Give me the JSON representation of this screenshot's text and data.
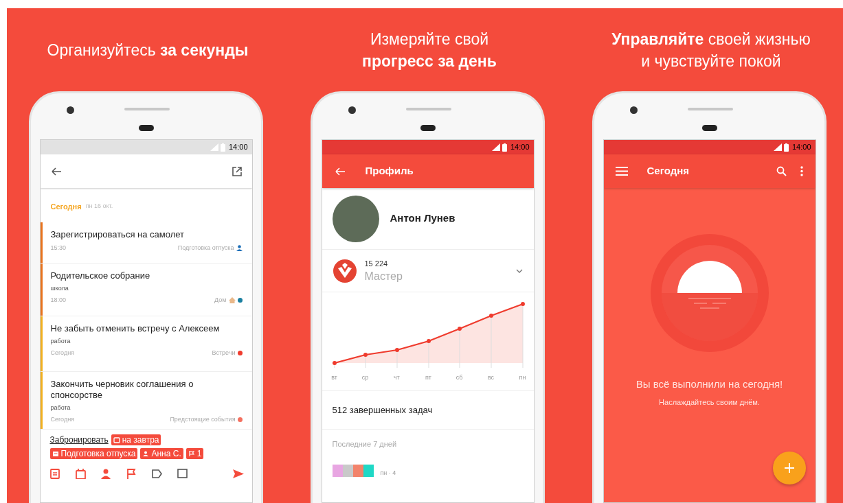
{
  "panels": [
    {
      "kind": "tasks",
      "headline": [
        "Организуйтесь **за секунды**"
      ],
      "status_time": "14:00",
      "section": {
        "title": "Сегодня",
        "date": "пн 16 окт."
      },
      "tasks": [
        {
          "title": "Зарегистрироваться на самолет",
          "time": "15:30",
          "project": "Подготовка отпуска",
          "color": "#e8721c",
          "marker": {
            "kind": "person",
            "color": "#1e6fb8"
          }
        },
        {
          "title": "Родительское собрание",
          "note": "школа",
          "time": "18:00",
          "project": "Дом",
          "color": "#e8721c",
          "marker": {
            "kind": "home",
            "color": "#1a7fa0"
          }
        },
        {
          "title": "Не забыть отменить встречу с Алексеем",
          "note": "работа",
          "time": "Сегодня",
          "project": "Встречи",
          "color": "#f2b01e",
          "marker": {
            "kind": "dot",
            "color": "#ef3b2d"
          }
        },
        {
          "title": "Закончить черновик соглашения о спонсорстве",
          "note": "работа",
          "time": "Сегодня",
          "project": "Предстоящие события",
          "color": "#f2b01e",
          "marker": {
            "kind": "dot",
            "color": "#f4705f"
          }
        }
      ],
      "compose": {
        "text": "Забронировать",
        "chips": [
          {
            "kind": "date",
            "label": "на завтра"
          },
          {
            "kind": "list",
            "label": "Подготовка отпуска"
          },
          {
            "kind": "person",
            "label": "Анна С."
          },
          {
            "kind": "flag",
            "label": "1"
          }
        ]
      }
    },
    {
      "kind": "profile",
      "headline": [
        "Измеряйте свой",
        "**прогресс за день**"
      ],
      "status_time": "14:00",
      "title": "Профиль",
      "name": "Антон Лунев",
      "karma": "15 224",
      "level": "Мастер",
      "chart_labels": [
        "вт",
        "ср",
        "чт",
        "пт",
        "сб",
        "вс",
        "пн"
      ],
      "completed": "512 завершенных задач",
      "recent": "Последние 7 дней",
      "recent_label": "пн · 4"
    },
    {
      "kind": "today",
      "headline": [
        "**Управляйте** своей жизнью",
        "и чувствуйте покой"
      ],
      "status_time": "14:00",
      "title": "Сегодня",
      "message": "Вы всё выполнили на сегодня!",
      "submessage": "Наслаждайтесь своим днём."
    }
  ]
}
